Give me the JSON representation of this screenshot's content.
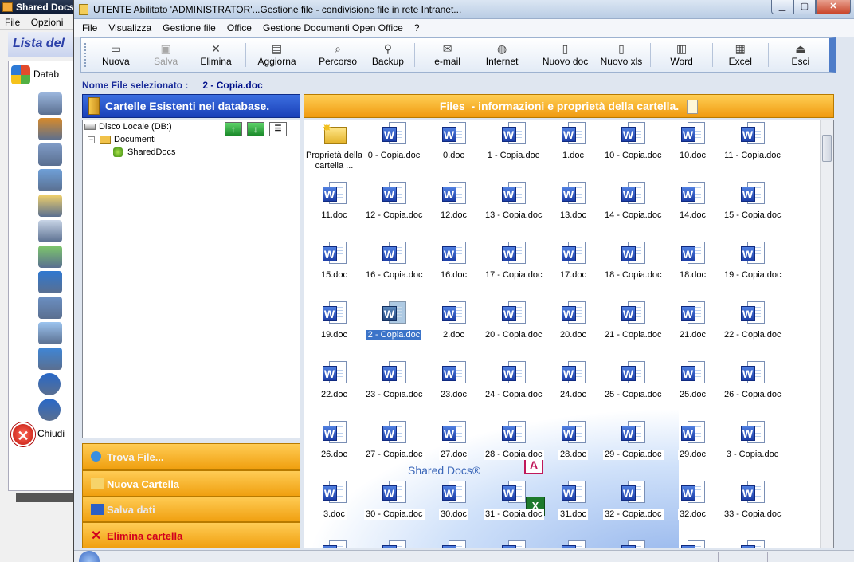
{
  "background_window": {
    "title": "Shared Docs",
    "menu": [
      "File",
      "Opzioni"
    ],
    "header": "Lista del",
    "db_label": "Datab",
    "close_label": "Chiudi",
    "icons": [
      "config-icon",
      "tools-icon",
      "users-icon",
      "monitor-icon",
      "folder-icon",
      "calendar-icon",
      "bug-icon",
      "ie-icon",
      "network-icon",
      "computer-icon",
      "globe-icon",
      "info-icon",
      "help-icon"
    ]
  },
  "window": {
    "title": "UTENTE Abilitato 'ADMINISTRATOR'...Gestione file - condivisione file in rete Intranet..."
  },
  "menu": [
    "File",
    "Visualizza",
    "Gestione file",
    "Office",
    "Gestione Documenti Open Office",
    "?"
  ],
  "toolbar": [
    {
      "label": "Nuova",
      "icon": "folder-icon",
      "enabled": true
    },
    {
      "label": "Salva",
      "icon": "save-icon",
      "enabled": false
    },
    {
      "label": "Elimina",
      "icon": "delete-icon",
      "enabled": true
    },
    {
      "label": "Aggiorna",
      "icon": "refresh-icon",
      "enabled": true
    },
    {
      "label": "Percorso",
      "icon": "path-icon",
      "enabled": true
    },
    {
      "label": "Backup",
      "icon": "backup-icon",
      "enabled": true
    },
    {
      "label": "e-mail",
      "icon": "email-icon",
      "enabled": true
    },
    {
      "label": "Internet",
      "icon": "internet-icon",
      "enabled": true
    },
    {
      "label": "Nuovo doc",
      "icon": "new-doc-icon",
      "enabled": true
    },
    {
      "label": "Nuovo xls",
      "icon": "new-xls-icon",
      "enabled": true
    },
    {
      "label": "Word",
      "icon": "word-icon",
      "enabled": true
    },
    {
      "label": "Excel",
      "icon": "excel-icon",
      "enabled": true
    },
    {
      "label": "Esci",
      "icon": "exit-icon",
      "enabled": true
    }
  ],
  "selection": {
    "label": "Nome File selezionato :",
    "value": "2 - Copia.doc"
  },
  "left_panel": {
    "title": "Cartelle Esistenti nel database.",
    "tree": {
      "disk": "Disco Locale (DB:)",
      "folder": "Documenti",
      "subfolder": "SharedDocs"
    },
    "tree_buttons": [
      "up-arrow-icon",
      "down-arrow-icon",
      "tree-list-icon"
    ],
    "actions": [
      {
        "label": "Trova File...",
        "icon": "search-icon",
        "kind": "trova"
      },
      {
        "label": "Nuova Cartella",
        "icon": "folder-icon",
        "kind": "nuova"
      },
      {
        "label": "Salva dati",
        "icon": "save-icon",
        "kind": "salva"
      },
      {
        "label": "Elimina cartella",
        "icon": "delete-icon",
        "kind": "elimina"
      }
    ]
  },
  "right_panel": {
    "title": "Files  - informazioni e proprietà della cartella.",
    "watermark": "Shared Docs®",
    "selected_file": "2 - Copia.doc",
    "files": [
      "Proprietà della cartella ...",
      "0 - Copia.doc",
      "0.doc",
      "1 - Copia.doc",
      "1.doc",
      "10 - Copia.doc",
      "10.doc",
      "11 - Copia.doc",
      "11.doc",
      "12 - Copia.doc",
      "12.doc",
      "13 - Copia.doc",
      "13.doc",
      "14 - Copia.doc",
      "14.doc",
      "15 - Copia.doc",
      "15.doc",
      "16 - Copia.doc",
      "16.doc",
      "17 - Copia.doc",
      "17.doc",
      "18 - Copia.doc",
      "18.doc",
      "19 - Copia.doc",
      "19.doc",
      "2 - Copia.doc",
      "2.doc",
      "20 - Copia.doc",
      "20.doc",
      "21 - Copia.doc",
      "21.doc",
      "22 - Copia.doc",
      "22.doc",
      "23 - Copia.doc",
      "23.doc",
      "24 - Copia.doc",
      "24.doc",
      "25 - Copia.doc",
      "25.doc",
      "26 - Copia.doc",
      "26.doc",
      "27 - Copia.doc",
      "27.doc",
      "28 - Copia.doc",
      "28.doc",
      "29 - Copia.doc",
      "29.doc",
      "3 - Copia.doc",
      "3.doc",
      "30 - Copia.doc",
      "30.doc",
      "31 - Copia.doc",
      "31.doc",
      "32 - Copia.doc",
      "32.doc",
      "33 - Copia.doc"
    ]
  }
}
